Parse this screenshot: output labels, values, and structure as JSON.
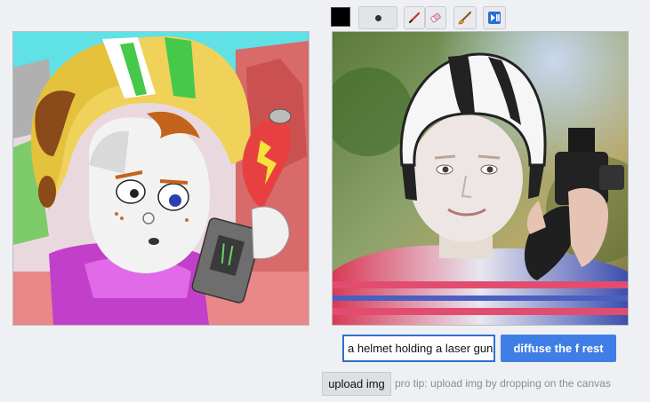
{
  "toolbar": {
    "color": "#000000",
    "tools": [
      {
        "name": "brush-size",
        "icon": "dot-icon"
      },
      {
        "name": "pen",
        "icon": "pen-icon"
      },
      {
        "name": "eraser",
        "icon": "eraser-icon"
      },
      {
        "name": "paint",
        "icon": "brush-icon"
      },
      {
        "name": "run",
        "icon": "play-pause-icon"
      }
    ]
  },
  "prompt": {
    "value": "a helmet holding a laser gun"
  },
  "buttons": {
    "diffuse": "diffuse the f rest",
    "upload": "upload img"
  },
  "tip": "pro tip: upload img by dropping on the canvas"
}
